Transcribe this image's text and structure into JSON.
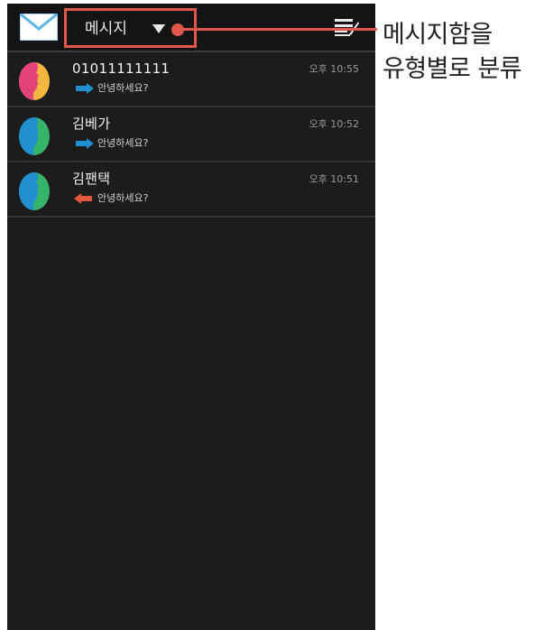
{
  "header": {
    "folder_label": "메시지"
  },
  "messages": [
    {
      "name": "01011111111",
      "time": "오후 10:55",
      "preview": "안녕하세요?",
      "direction": "outgoing",
      "avatar_colors": [
        "#e4437a",
        "#f3b63e"
      ]
    },
    {
      "name": "김베가",
      "time": "오후 10:52",
      "preview": "안녕하세요?",
      "direction": "outgoing",
      "avatar_colors": [
        "#1f8fcf",
        "#36b56a"
      ]
    },
    {
      "name": "김팬택",
      "time": "오후 10:51",
      "preview": "안녕하세요?",
      "direction": "incoming",
      "avatar_colors": [
        "#1f8fcf",
        "#36b56a"
      ]
    }
  ],
  "annotation": {
    "line1": "메시지함을",
    "line2": "유형별로 분류"
  },
  "colors": {
    "accent": "#e2574c",
    "outgoing_arrow": "#1f8fcf",
    "incoming_arrow": "#e0593a",
    "background": "#1c1c1c"
  },
  "icons": {
    "app": "envelope-icon",
    "compose": "compose-icon",
    "folder": "caret-down-icon"
  }
}
